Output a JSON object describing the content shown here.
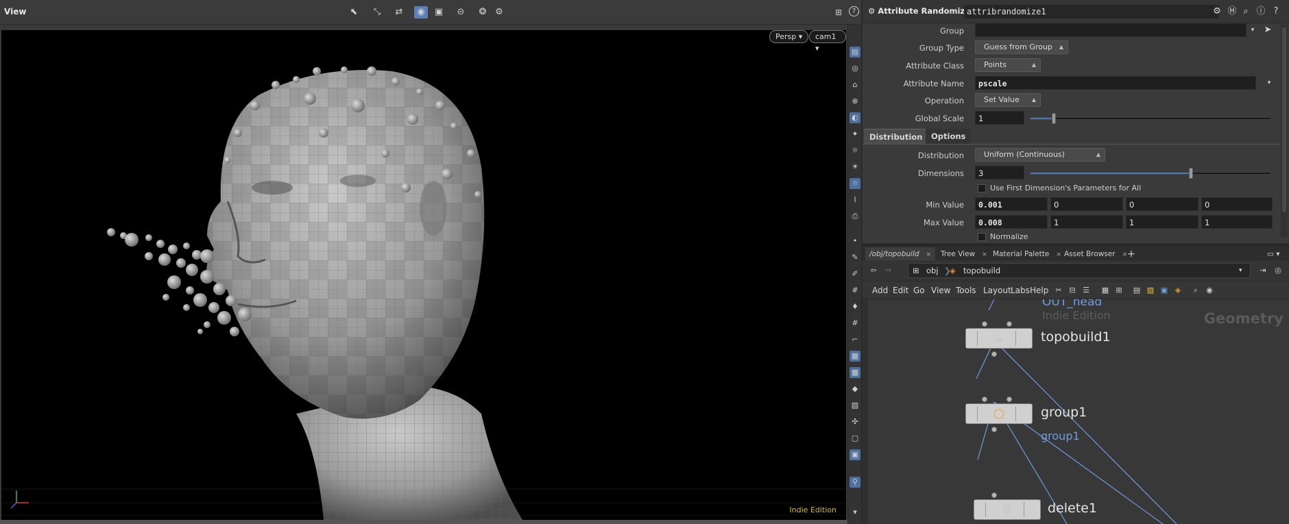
{
  "viewer": {
    "title": "View",
    "persp_label": "Persp ▾",
    "cam_label": "cam1 ▾",
    "edition": "Indie Edition",
    "toolbar_icons": [
      "select-icon",
      "move-icon",
      "transform-icon",
      "display-icon",
      "snap-icon",
      "stop-icon",
      "camera-icon",
      "settings-icon"
    ],
    "help": "?"
  },
  "parameters": {
    "node_type": "Attribute Randomize",
    "node_name": "attribrandomize1",
    "group_label": "Group",
    "group_value": "",
    "group_type_label": "Group Type",
    "group_type_value": "Guess from Group",
    "attr_class_label": "Attribute Class",
    "attr_class_value": "Points",
    "attr_name_label": "Attribute Name",
    "attr_name_value": "pscale",
    "operation_label": "Operation",
    "operation_value": "Set Value",
    "global_scale_label": "Global Scale",
    "global_scale_value": "1",
    "tabs": [
      "Distribution",
      "Options"
    ],
    "distribution_label": "Distribution",
    "distribution_value": "Uniform (Continuous)",
    "dimensions_label": "Dimensions",
    "dimensions_value": "3",
    "use_first_label": "Use First Dimension's Parameters for All",
    "min_label": "Min Value",
    "min_values": [
      "0.001",
      "0",
      "0",
      "0"
    ],
    "max_label": "Max Value",
    "max_values": [
      "0.008",
      "1",
      "1",
      "1"
    ],
    "normalize_label": "Normalize"
  },
  "network": {
    "tabs": [
      {
        "label": "/obj/topobuild",
        "close": "×"
      },
      {
        "label": "Tree View",
        "close": "×"
      },
      {
        "label": "Material Palette",
        "close": "×"
      },
      {
        "label": "Asset Browser",
        "close": "×"
      }
    ],
    "add_tab": "+",
    "path": [
      "obj",
      "topobuild"
    ],
    "menu": [
      "Add",
      "Edit",
      "Go",
      "View",
      "Tools",
      "Layout",
      "Labs",
      "Help"
    ],
    "context_label": "Geometry",
    "nodes": {
      "out_head": {
        "name": "OUT_head",
        "sub": "Indie Edition"
      },
      "topobuild1": {
        "name": "topobuild1"
      },
      "group1": {
        "name": "group1",
        "sub": "group1"
      },
      "delete1": {
        "name": "delete1"
      }
    }
  },
  "colors": {
    "accent": "#5d7fb8",
    "wire": "#6f9be0",
    "indie": "#d8b93a"
  }
}
